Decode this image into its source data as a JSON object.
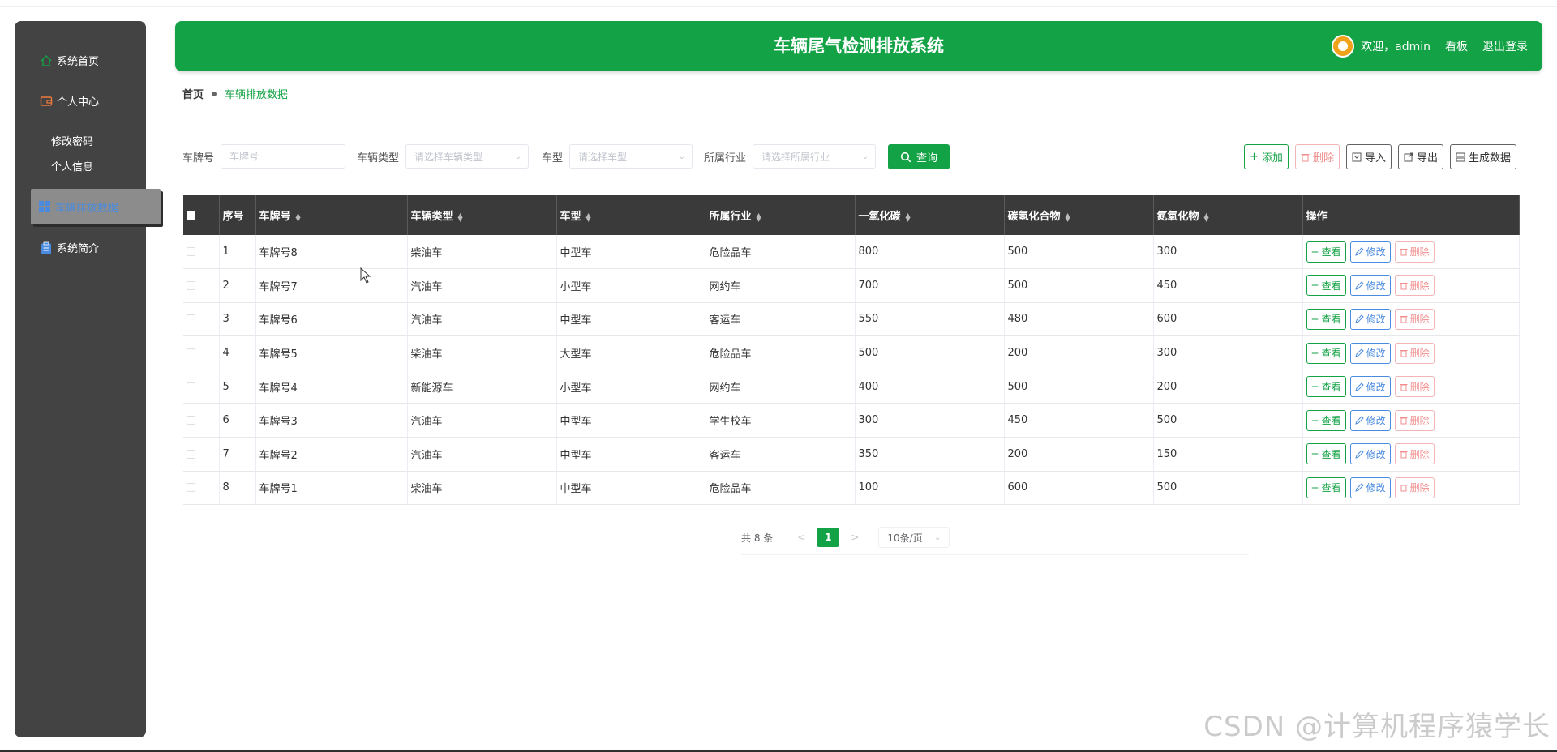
{
  "app": {
    "title": "车辆尾气检测排放系统",
    "welcome": "欢迎，admin",
    "board_link": "看板",
    "logout_link": "退出登录"
  },
  "sidebar": {
    "items": [
      {
        "label": "系统首页",
        "icon": "home-icon"
      },
      {
        "label": "个人中心",
        "icon": "wallet-icon"
      },
      {
        "label": "修改密码"
      },
      {
        "label": "个人信息"
      },
      {
        "label": "车辆排放数据",
        "icon": "grid-icon",
        "active": true
      },
      {
        "label": "系统简介",
        "icon": "clipboard-icon"
      }
    ]
  },
  "breadcrumb": {
    "home": "首页",
    "current": "车辆排放数据"
  },
  "filters": {
    "plate_label": "车牌号",
    "plate_placeholder": "车牌号",
    "vehicle_type_label": "车辆类型",
    "vehicle_type_placeholder": "请选择车辆类型",
    "model_label": "车型",
    "model_placeholder": "请选择车型",
    "industry_label": "所属行业",
    "industry_placeholder": "请选择所属行业",
    "query_label": "查询"
  },
  "actions": {
    "add": "添加",
    "delete": "删除",
    "import": "导入",
    "export": "导出",
    "generate": "生成数据"
  },
  "table": {
    "headers": [
      "序号",
      "车牌号",
      "车辆类型",
      "车型",
      "所属行业",
      "一氧化碳",
      "碳氢化合物",
      "氮氧化物",
      "操作"
    ],
    "rows": [
      {
        "no": "1",
        "plate": "车牌号8",
        "type": "柴油车",
        "model": "中型车",
        "industry": "危险品车",
        "co": "800",
        "hc": "500",
        "nox": "300"
      },
      {
        "no": "2",
        "plate": "车牌号7",
        "type": "汽油车",
        "model": "小型车",
        "industry": "网约车",
        "co": "700",
        "hc": "500",
        "nox": "450"
      },
      {
        "no": "3",
        "plate": "车牌号6",
        "type": "汽油车",
        "model": "中型车",
        "industry": "客运车",
        "co": "550",
        "hc": "480",
        "nox": "600"
      },
      {
        "no": "4",
        "plate": "车牌号5",
        "type": "柴油车",
        "model": "大型车",
        "industry": "危险品车",
        "co": "500",
        "hc": "200",
        "nox": "300"
      },
      {
        "no": "5",
        "plate": "车牌号4",
        "type": "新能源车",
        "model": "小型车",
        "industry": "网约车",
        "co": "400",
        "hc": "500",
        "nox": "200"
      },
      {
        "no": "6",
        "plate": "车牌号3",
        "type": "汽油车",
        "model": "中型车",
        "industry": "学生校车",
        "co": "300",
        "hc": "450",
        "nox": "500"
      },
      {
        "no": "7",
        "plate": "车牌号2",
        "type": "汽油车",
        "model": "中型车",
        "industry": "客运车",
        "co": "350",
        "hc": "200",
        "nox": "150"
      },
      {
        "no": "8",
        "plate": "车牌号1",
        "type": "柴油车",
        "model": "中型车",
        "industry": "危险品车",
        "co": "100",
        "hc": "600",
        "nox": "500"
      }
    ],
    "row_actions": {
      "view": "查看",
      "edit": "修改",
      "delete": "删除"
    }
  },
  "pagination": {
    "total": "共 8 条",
    "prev": "<",
    "page": "1",
    "next": ">",
    "page_size": "10条/页"
  },
  "watermark": "CSDN @计算机程序猿学长",
  "colors": {
    "primary": "#13a245",
    "sidebar_bg": "#434343",
    "header_bg": "#13a245",
    "table_head_bg": "#3a3a3a",
    "edit_blue": "#4a8bdf",
    "delete_red": "#f08c8c"
  }
}
